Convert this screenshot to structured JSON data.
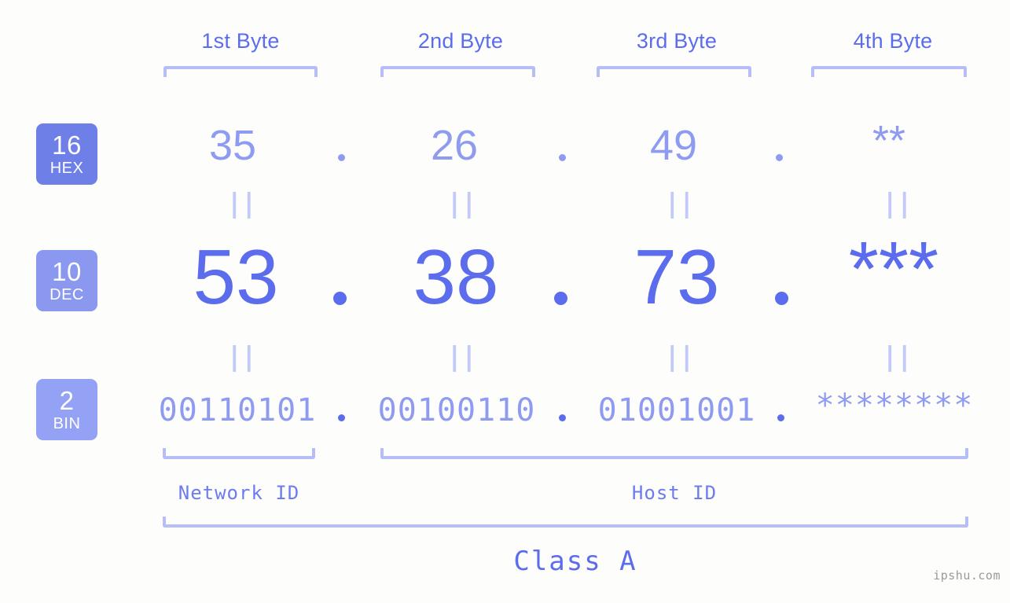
{
  "background_color": "#fdfdfb",
  "accent_color": "#5b6ced",
  "accent_light_color": "#8e9bf0",
  "bracket_color": "#b6bdf7",
  "byte_headers": [
    {
      "label": "1st Byte"
    },
    {
      "label": "2nd Byte"
    },
    {
      "label": "3rd Byte"
    },
    {
      "label": "4th Byte"
    }
  ],
  "bases": [
    {
      "num": "16",
      "label": "HEX",
      "color": "#6f7fe8"
    },
    {
      "num": "10",
      "label": "DEC",
      "color": "#8a98f0"
    },
    {
      "num": "2",
      "label": "BIN",
      "color": "#93a2f4"
    }
  ],
  "rows": {
    "hex": {
      "base_num": "16",
      "base_label": "HEX",
      "values": [
        "35",
        "26",
        "49",
        "**"
      ]
    },
    "dec": {
      "base_num": "10",
      "base_label": "DEC",
      "values": [
        "53",
        "38",
        "73",
        "***"
      ]
    },
    "bin": {
      "base_num": "2",
      "base_label": "BIN",
      "values": [
        "00110101",
        "00100110",
        "01001001",
        "********"
      ]
    }
  },
  "separator": ".",
  "equals_glyph": "||",
  "id_labels": {
    "network": "Network ID",
    "host": "Host ID"
  },
  "class_label": "Class A",
  "watermark": "ipshu.com"
}
